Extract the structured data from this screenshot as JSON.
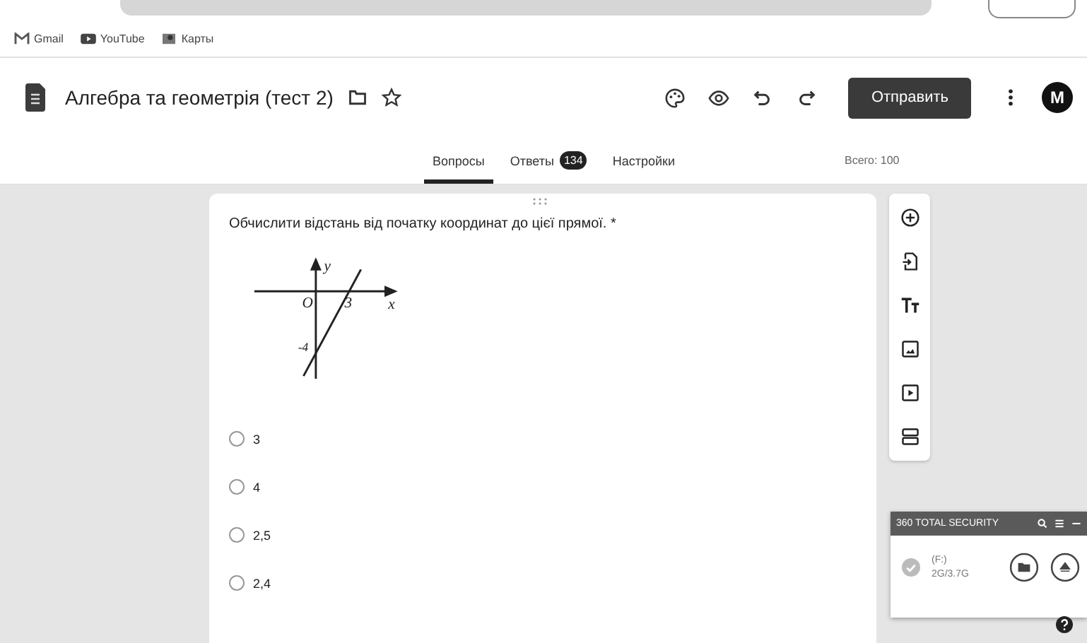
{
  "bookmarks": [
    {
      "label": "Gmail",
      "kind": "gmail"
    },
    {
      "label": "YouTube",
      "kind": "youtube"
    },
    {
      "label": "Карты",
      "kind": "maps"
    }
  ],
  "header": {
    "title": "Алгебра та геометрія (тест 2)",
    "send_button": "Отправить",
    "avatar": "M"
  },
  "tabs": [
    {
      "label": "Вопросы",
      "selected": true
    },
    {
      "label": "Ответы",
      "selected": false,
      "badge": "134"
    },
    {
      "label": "Настройки",
      "selected": false
    }
  ],
  "total": "Всего: 100",
  "question": {
    "text": "Обчислити відстань від початку координат до цієї прямої. *",
    "diagram": {
      "y_label": "y",
      "x_label": "x",
      "origin_label": "O",
      "x_intercept": "3",
      "y_intercept": "-4"
    },
    "options": [
      {
        "label": "3",
        "selected": false
      },
      {
        "label": "4",
        "selected": false
      },
      {
        "label": "2,5",
        "selected": false
      },
      {
        "label": "2,4",
        "selected": false
      }
    ]
  },
  "security_popup": {
    "title": "360 TOTAL SECURITY",
    "drive": "(F:)",
    "usage": "2G/3.7G"
  }
}
